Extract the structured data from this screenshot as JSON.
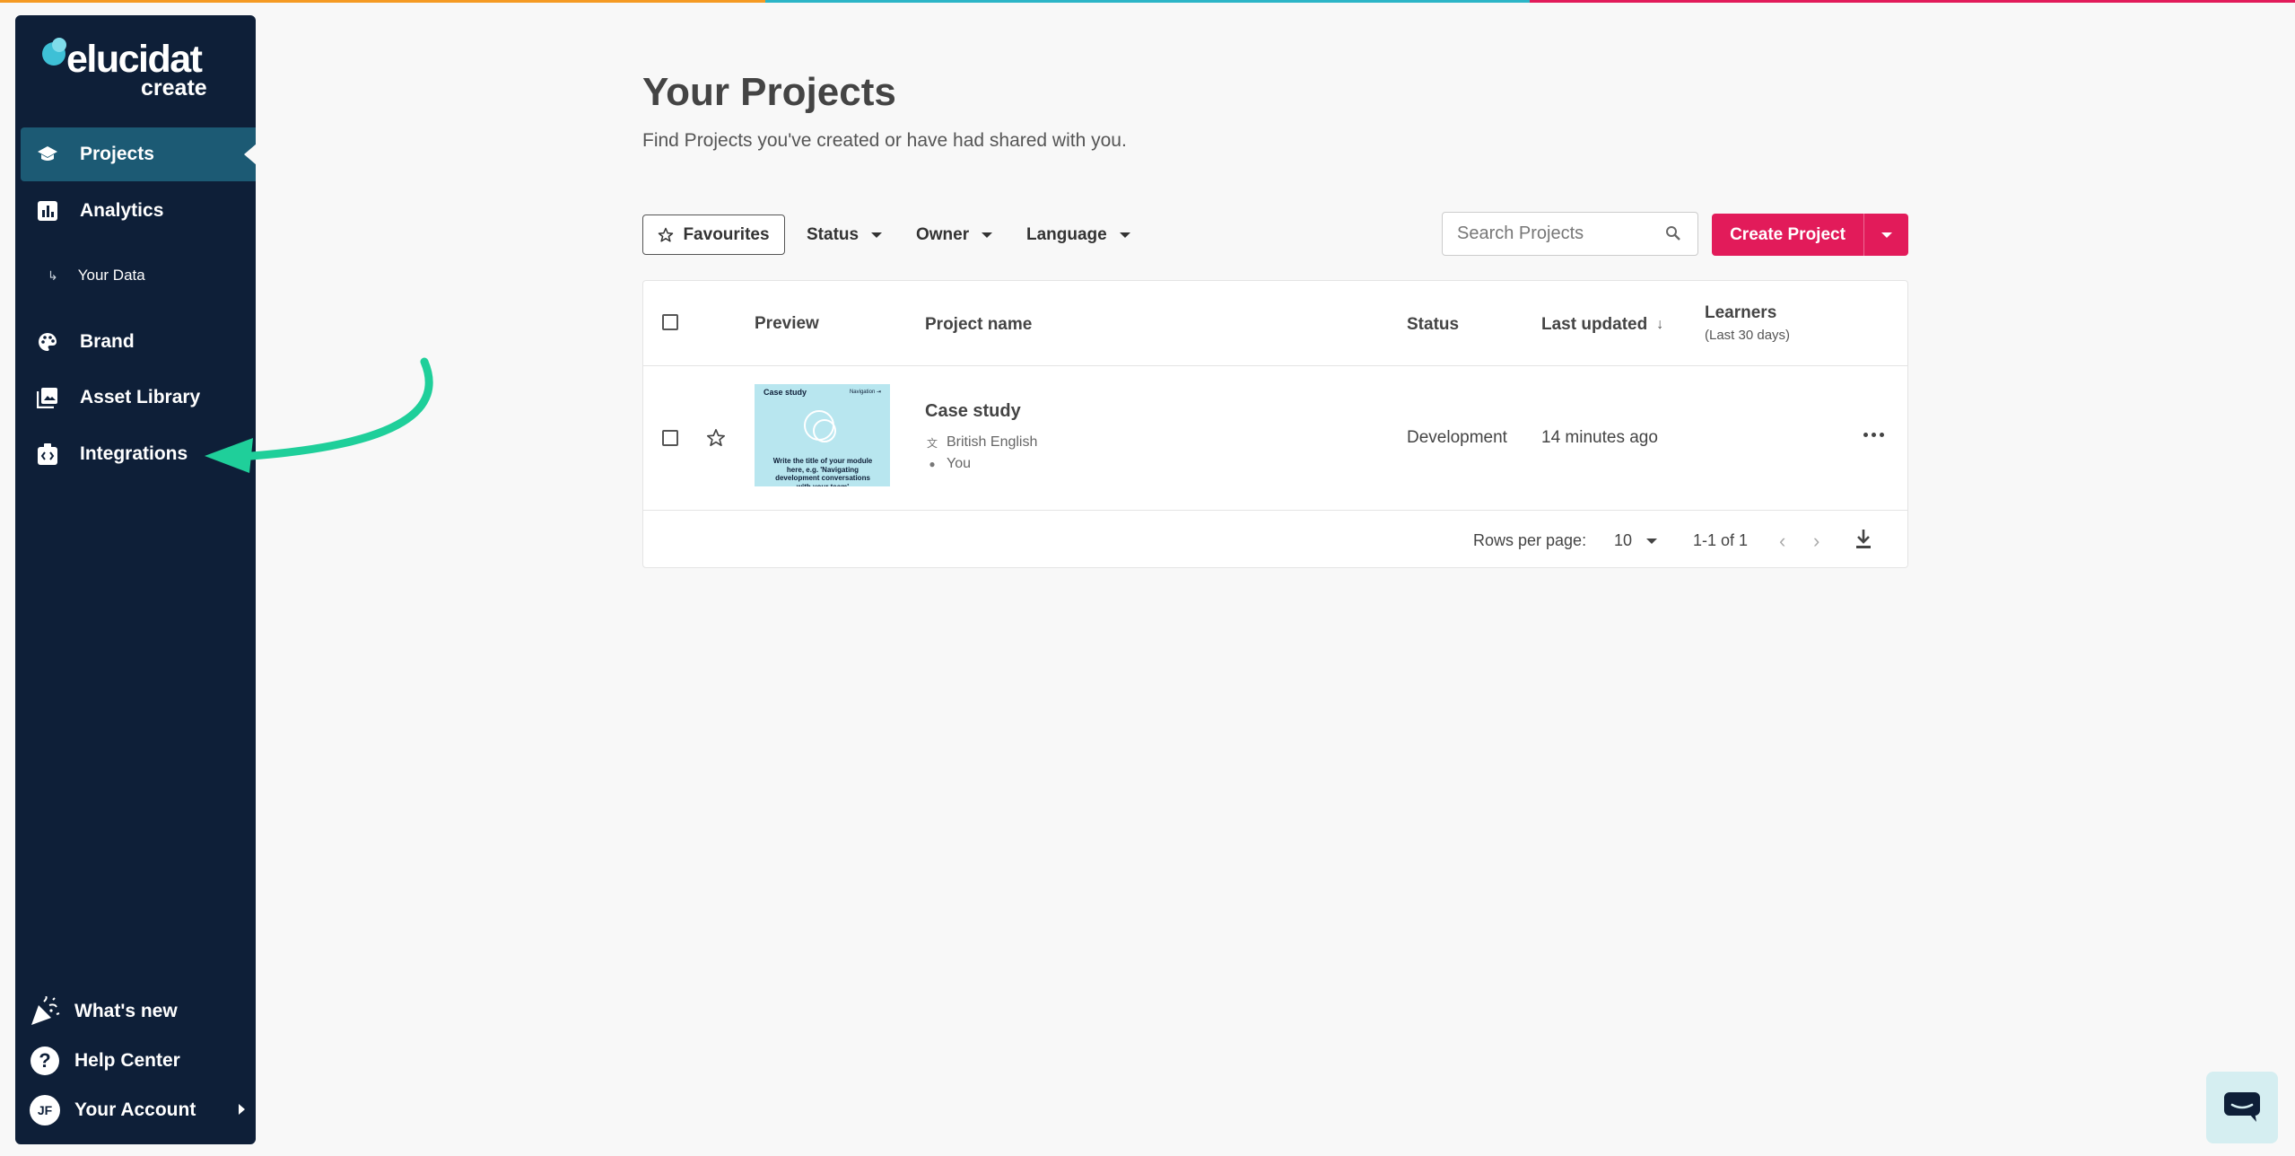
{
  "colors": {
    "sidebar_bg": "#0e1f38",
    "active_nav_bg": "#1c5a74",
    "primary": "#e21b5a",
    "annotation_arrow": "#1fcf9a",
    "topbar": [
      "#f59a23",
      "#2cb5c7",
      "#e21b5a"
    ]
  },
  "brand": {
    "name": "elucidat",
    "product": "create"
  },
  "sidebar": {
    "items": [
      {
        "label": "Projects",
        "icon": "graduation-cap-icon",
        "active": true
      },
      {
        "label": "Analytics",
        "icon": "bar-chart-icon"
      },
      {
        "label": "Brand",
        "icon": "palette-icon"
      },
      {
        "label": "Asset Library",
        "icon": "image-library-icon"
      },
      {
        "label": "Integrations",
        "icon": "integrations-icon"
      }
    ],
    "subitem": {
      "label": "Your Data",
      "icon": "return-arrow-icon"
    },
    "bottom": {
      "whats_new": "What's new",
      "help": "Help Center",
      "account": "Your Account",
      "avatar_initials": "JF"
    }
  },
  "header": {
    "title": "Your Projects",
    "subtitle": "Find Projects you've created or have had shared with you."
  },
  "toolbar": {
    "favourites": "Favourites",
    "filters": [
      "Status",
      "Owner",
      "Language"
    ],
    "search_placeholder": "Search Projects",
    "create_label": "Create Project"
  },
  "table": {
    "columns": {
      "preview": "Preview",
      "name": "Project name",
      "status": "Status",
      "updated": "Last updated",
      "learners": "Learners",
      "learners_sub": "(Last 30 days)"
    },
    "rows": [
      {
        "name": "Case study",
        "language": "British English",
        "owner": "You",
        "status": "Development",
        "updated": "14 minutes ago",
        "thumb_title": "Case study",
        "thumb_nav": "Navigation ⇥",
        "thumb_text": "Write the title of your module here, e.g. 'Navigating development conversations with your team'"
      }
    ],
    "footer": {
      "rows_per_page_label": "Rows per page:",
      "rows_per_page": "10",
      "range": "1-1 of 1"
    }
  }
}
